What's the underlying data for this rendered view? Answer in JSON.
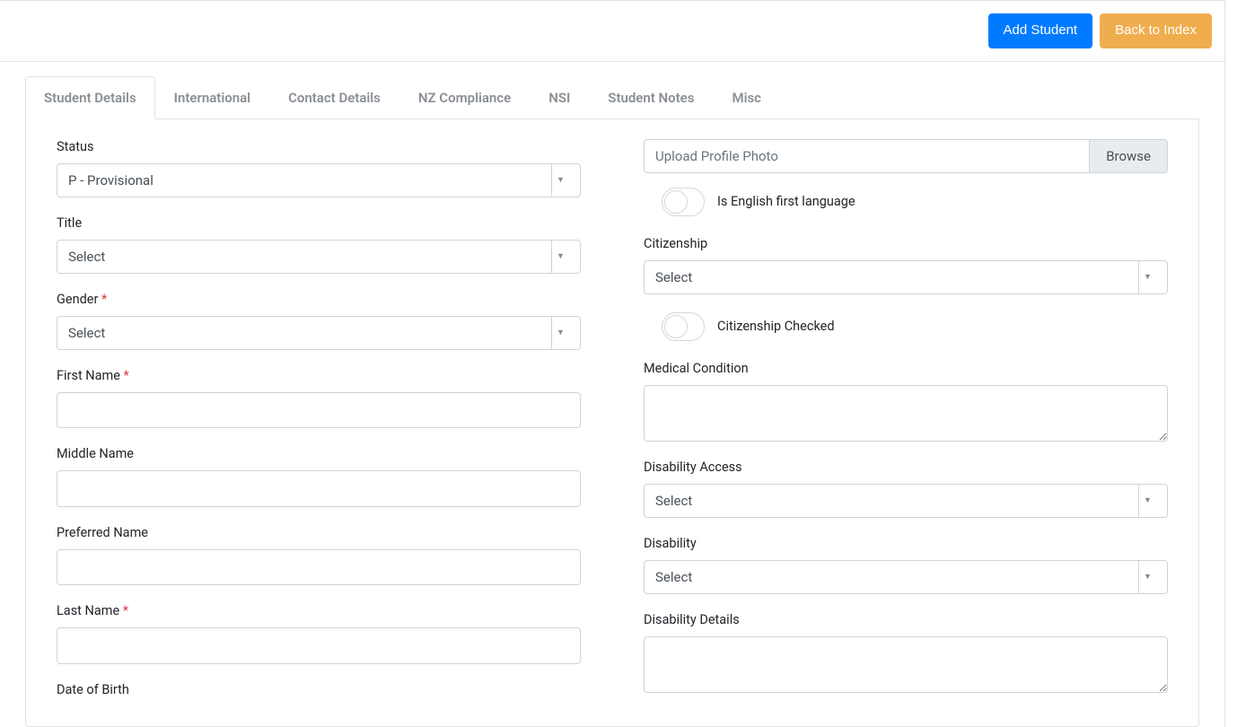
{
  "header": {
    "add_student": "Add Student",
    "back_to_index": "Back to Index"
  },
  "tabs": [
    {
      "label": "Student Details",
      "active": true
    },
    {
      "label": "International",
      "active": false
    },
    {
      "label": "Contact Details",
      "active": false
    },
    {
      "label": "NZ Compliance",
      "active": false
    },
    {
      "label": "NSI",
      "active": false
    },
    {
      "label": "Student Notes",
      "active": false
    },
    {
      "label": "Misc",
      "active": false
    }
  ],
  "left": {
    "status_label": "Status",
    "status_value": "P - Provisional",
    "title_label": "Title",
    "title_value": "Select",
    "gender_label": "Gender",
    "gender_value": "Select",
    "first_name_label": "First Name",
    "middle_name_label": "Middle Name",
    "preferred_name_label": "Preferred Name",
    "last_name_label": "Last Name",
    "dob_label": "Date of Birth"
  },
  "right": {
    "upload_placeholder": "Upload Profile Photo",
    "browse_label": "Browse",
    "english_first_label": "Is English first language",
    "citizenship_label": "Citizenship",
    "citizenship_value": "Select",
    "citizenship_checked_label": "Citizenship Checked",
    "medical_label": "Medical Condition",
    "disability_access_label": "Disability Access",
    "disability_access_value": "Select",
    "disability_label": "Disability",
    "disability_value": "Select",
    "disability_details_label": "Disability Details"
  }
}
